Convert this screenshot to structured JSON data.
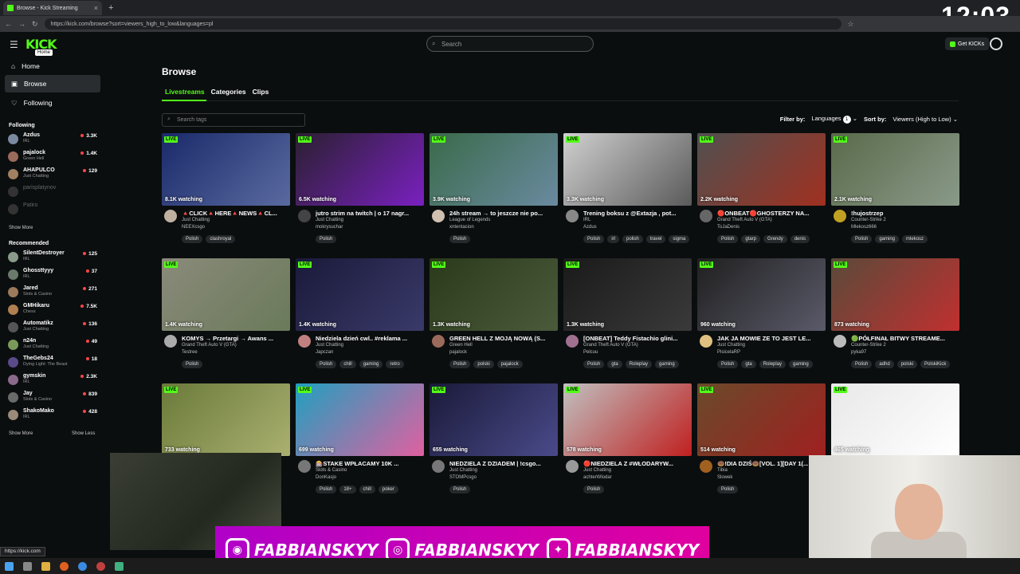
{
  "browser": {
    "tab_title": "Browse - Kick Streaming",
    "tab_close": "×",
    "new_tab": "+",
    "url": "https://kick.com/browse?sort=viewers_high_to_low&languages=pl",
    "status_url": "https://kick.com"
  },
  "clock": "12:03",
  "header": {
    "logo": "KICK",
    "logo_tooltip": "Home",
    "search_placeholder": "Search",
    "get_kicks": "Get KICKs"
  },
  "sidebar": {
    "nav": [
      {
        "label": "Home",
        "icon": "home-icon"
      },
      {
        "label": "Browse",
        "icon": "browse-icon"
      },
      {
        "label": "Following",
        "icon": "heart-icon"
      }
    ],
    "following_title": "Following",
    "following": [
      {
        "name": "Azdus",
        "category": "IRL",
        "viewers": "3.3K",
        "avatar": "#7a8aa0"
      },
      {
        "name": "pajalock",
        "category": "Green Hell",
        "viewers": "1.4K",
        "avatar": "#9a6a5a"
      },
      {
        "name": "AHAPULCO",
        "category": "Just Chatting",
        "viewers": "129",
        "avatar": "#a08060"
      },
      {
        "name": "parisplatynov",
        "category": "",
        "viewers": "",
        "avatar": "#333"
      },
      {
        "name": "Patiro",
        "category": "",
        "viewers": "",
        "avatar": "#333"
      }
    ],
    "show_more_1": "Show More",
    "recommended_title": "Recommended",
    "recommended": [
      {
        "name": "SilentDestroyer",
        "category": "IRL",
        "viewers": "125",
        "avatar": "#8a9a8a"
      },
      {
        "name": "Ghossttyyy",
        "category": "IRL",
        "viewers": "37",
        "avatar": "#6a7a6a"
      },
      {
        "name": "Jared",
        "category": "Slots & Casino",
        "viewers": "271",
        "avatar": "#9a7a5a"
      },
      {
        "name": "GMHikaru",
        "category": "Chess",
        "viewers": "7.5K",
        "avatar": "#b08050"
      },
      {
        "name": "Automatikz",
        "category": "Just Chatting",
        "viewers": "136",
        "avatar": "#555"
      },
      {
        "name": "n24n",
        "category": "Just Chatting",
        "viewers": "49",
        "avatar": "#7a9a5a"
      },
      {
        "name": "TheGebs24",
        "category": "Dying Light: The Beast",
        "viewers": "18",
        "avatar": "#5a4a8a"
      },
      {
        "name": "gymskin",
        "category": "IRL",
        "viewers": "2.3K",
        "avatar": "#8a6a8a"
      },
      {
        "name": "Jay",
        "category": "Slots & Casino",
        "viewers": "839",
        "avatar": "#6a6a6a"
      },
      {
        "name": "ShakoMako",
        "category": "IRL",
        "viewers": "428",
        "avatar": "#9a8a7a"
      }
    ],
    "show_more_2": "Show More",
    "show_less": "Show Less"
  },
  "main": {
    "title": "Browse",
    "tabs": [
      "Livestreams",
      "Categories",
      "Clips"
    ],
    "tag_search_placeholder": "Search tags",
    "filter_label": "Filter by:",
    "filter_value": "Languages",
    "filter_count": "1",
    "sort_label": "Sort by:",
    "sort_value": "Viewers (High to Low)",
    "live_label": "LIVE",
    "streams": [
      {
        "title": "🔺CLICK🔺HERE🔺NEWS🔺CL...",
        "category": "Just Chatting",
        "streamer": "NEEXcsgo",
        "watching": "8.1K watching",
        "tags": [
          "Polish",
          "clashroyal"
        ],
        "color1": "#1a2a6a",
        "color2": "#5a6aa0",
        "avatar": "#c0b0a0"
      },
      {
        "title": "jutro strim na twitch | o 17 nagr...",
        "category": "Just Chatting",
        "streamer": "mokrysuchar",
        "watching": "6.5K watching",
        "tags": [
          "Polish"
        ],
        "color1": "#2a2030",
        "color2": "#7a20c0",
        "avatar": "#444"
      },
      {
        "title": "24h stream → to jeszcze nie po...",
        "category": "League of Legends",
        "streamer": "xntentacion",
        "watching": "3.9K watching",
        "tags": [
          "Polish"
        ],
        "color1": "#3a6a4a",
        "color2": "#6a8aa0",
        "avatar": "#d0c0b0"
      },
      {
        "title": "Trening boksu z @Extazja , pot...",
        "category": "IRL",
        "streamer": "Azdus",
        "watching": "3.3K watching",
        "tags": [
          "Polish",
          "irl",
          "polish",
          "travel",
          "sigma"
        ],
        "color1": "#d0d0d0",
        "color2": "#5a5a5a",
        "avatar": "#888"
      },
      {
        "title": "🔴ONBEAT🔴GHOSTERZY NA...",
        "category": "Grand Theft Auto V (GTA)",
        "streamer": "ToJaDenis",
        "watching": "2.2K watching",
        "tags": [
          "Polish",
          "gtarp",
          "Grendy",
          "denis"
        ],
        "color1": "#505050",
        "color2": "#a03020",
        "avatar": "#666"
      },
      {
        "title": "!hujostrzep",
        "category": "Counter-Strike 2",
        "streamer": "Mlekosz666",
        "watching": "2.1K watching",
        "tags": [
          "Polish",
          "gaming",
          "mlekosz"
        ],
        "color1": "#5a6a4a",
        "color2": "#8a9a8a",
        "avatar": "#c0a020"
      },
      {
        "title": "KOMYS → Przetargi → Awans ...",
        "category": "Grand Theft Auto V (GTA)",
        "streamer": "Testree",
        "watching": "1.4K watching",
        "tags": [
          "Polish"
        ],
        "color1": "#8a8a7a",
        "color2": "#6a7a5a",
        "avatar": "#aaa"
      },
      {
        "title": "Niedziela dzień cwl.. #reklama ...",
        "category": "Just Chatting",
        "streamer": "Japczan",
        "watching": "1.4K watching",
        "tags": [
          "Polish",
          "chill",
          "gaming",
          "retro"
        ],
        "color1": "#1a1a3a",
        "color2": "#3a3a6a",
        "avatar": "#c08080"
      },
      {
        "title": "GREEN HELL Z MOJĄ NOWĄ (S...",
        "category": "Green Hell",
        "streamer": "pajalock",
        "watching": "1.3K watching",
        "tags": [
          "Polish",
          "polski",
          "pajalock"
        ],
        "color1": "#2a3a1a",
        "color2": "#4a5a3a",
        "avatar": "#9a6a5a"
      },
      {
        "title": "[ONBEAT] Teddy Fistachio glini...",
        "category": "Grand Theft Auto V (GTA)",
        "streamer": "Pelcuu",
        "watching": "1.3K watching",
        "tags": [
          "Polish",
          "gta",
          "Roleplay",
          "gaming"
        ],
        "color1": "#1a1a1a",
        "color2": "#3a3a3a",
        "avatar": "#a07090"
      },
      {
        "title": "JAK JA MOWIE ZE TO JEST LE...",
        "category": "Just Chatting",
        "streamer": "PisicelaRP",
        "watching": "960 watching",
        "tags": [
          "Polish",
          "gta",
          "Roleplay",
          "gaming"
        ],
        "color1": "#202020",
        "color2": "#5a5a6a",
        "avatar": "#e0c080"
      },
      {
        "title": "🟢PÓŁFINAŁ BITWY STREAME...",
        "category": "Counter-Strike 2",
        "streamer": "pyka97",
        "watching": "873 watching",
        "tags": [
          "Polish",
          "adhd",
          "polski",
          "PolskiKick"
        ],
        "color1": "#5a4a3a",
        "color2": "#c03030",
        "avatar": "#bbb"
      },
      {
        "title": "",
        "category": "",
        "streamer": "",
        "watching": "733 watching",
        "tags": [],
        "color1": "#6a7a3a",
        "color2": "#aab070",
        "avatar": "#777"
      },
      {
        "title": "🎰STAKE WPŁACAMY 10K ...",
        "category": "Slots & Casino",
        "streamer": "DonKasjo",
        "watching": "699 watching",
        "tags": [
          "Polish",
          "18+",
          "chill",
          "poker"
        ],
        "color1": "#20a0c0",
        "color2": "#e060a0",
        "avatar": "#777"
      },
      {
        "title": "NIEDZIELA Z DZIADEM | !csgo...",
        "category": "Just Chatting",
        "streamer": "STOMPcsgo",
        "watching": "655 watching",
        "tags": [
          "Polish"
        ],
        "color1": "#1a1a3a",
        "color2": "#4a4a8a",
        "avatar": "#777"
      },
      {
        "title": "🔴NIEDZIELA Z #WŁODARYW...",
        "category": "Just Chatting",
        "streamer": "achterWlodar",
        "watching": "578 watching",
        "tags": [
          "Polish"
        ],
        "color1": "#c0c0c0",
        "color2": "#c02020",
        "avatar": "#999"
      },
      {
        "title": "🍩!DIA DZIŚ🍩[VOL. 1][DAY 1(...",
        "category": "Tibia",
        "streamer": "Slowek",
        "watching": "514 watching",
        "tags": [
          "Polish"
        ],
        "color1": "#6a4a2a",
        "color2": "#a02020",
        "avatar": "#a06020"
      },
      {
        "title": "",
        "category": "",
        "streamer": "",
        "watching": "465 watching",
        "tags": [],
        "color1": "#e8e8e8",
        "color2": "#ffffff",
        "avatar": "#777"
      }
    ]
  },
  "overlay": {
    "social": [
      {
        "handle": "FABBIANSKYY",
        "icon": "discord-icon",
        "glyph": "◉"
      },
      {
        "handle": "FABBIANSKYY",
        "icon": "instagram-icon",
        "glyph": "◎"
      },
      {
        "handle": "FABBIANSKYY",
        "icon": "twitter-icon",
        "glyph": "✦"
      }
    ]
  }
}
